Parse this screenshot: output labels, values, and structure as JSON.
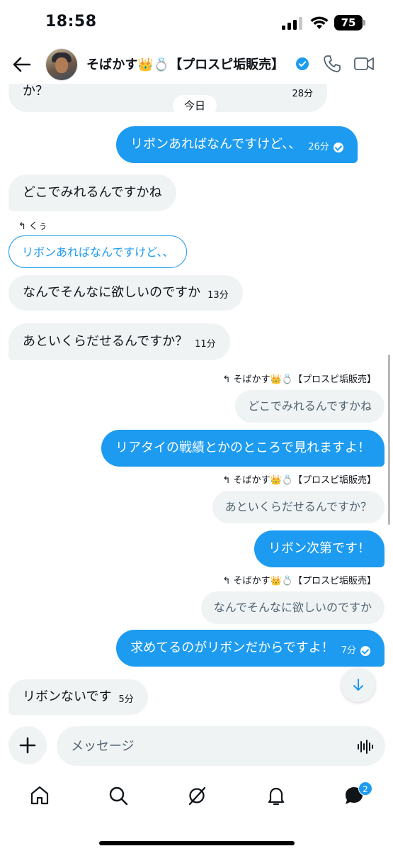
{
  "status": {
    "time": "18:58",
    "battery": "75"
  },
  "header": {
    "name": "そばかす👑💍【プロスピ垢販売】"
  },
  "chat": {
    "date_pill": "今日",
    "messages": [
      {
        "id": "m1",
        "dir": "in",
        "text": "か？",
        "time": "28分"
      },
      {
        "id": "m2",
        "dir": "out",
        "text": "リボンあればなんですけど、、",
        "time": "26分"
      },
      {
        "id": "m3",
        "dir": "in",
        "text": "どこでみれるんですかね"
      },
      {
        "id": "m4",
        "dir": "in",
        "reply_to_name": "くぅ",
        "quote": "リボンあればなんですけど、、",
        "text": "なんでそんなに欲しいのですか",
        "time": "13分"
      },
      {
        "id": "m5",
        "dir": "in",
        "text": "あといくらだせるんですか？",
        "time": "11分"
      },
      {
        "id": "m6",
        "dir": "out",
        "reply_to_name": "そばかす👑💍【プロスピ垢販売】",
        "quote": "どこでみれるんですかね",
        "text": "リアタイの戦績とかのところで見れますよ！"
      },
      {
        "id": "m7",
        "dir": "out",
        "reply_to_name": "そばかす👑💍【プロスピ垢販売】",
        "quote": "あといくらだせるんですか？",
        "text": "リボン次第です！"
      },
      {
        "id": "m8",
        "dir": "out",
        "reply_to_name": "そばかす👑💍【プロスピ垢販売】",
        "quote": "なんでそんなに欲しいのですか",
        "text": "求めてるのがリボンだからですよ！",
        "time": "7分"
      },
      {
        "id": "m9",
        "dir": "in",
        "text": "リボンないです",
        "time": "5分"
      }
    ]
  },
  "composer": {
    "placeholder": "メッセージ"
  },
  "nav": {
    "messages_badge": "2"
  },
  "colors": {
    "accent": "#1d9bf0",
    "bubble_in": "#eff3f4",
    "text": "#0f1419"
  },
  "icons": [
    "back-arrow-icon",
    "verified-icon",
    "phone-icon",
    "video-icon",
    "reply-arrow-icon",
    "chevron-down-icon",
    "plus-icon",
    "voice-icon",
    "home-icon",
    "search-icon",
    "grok-icon",
    "bell-icon",
    "messages-icon"
  ]
}
